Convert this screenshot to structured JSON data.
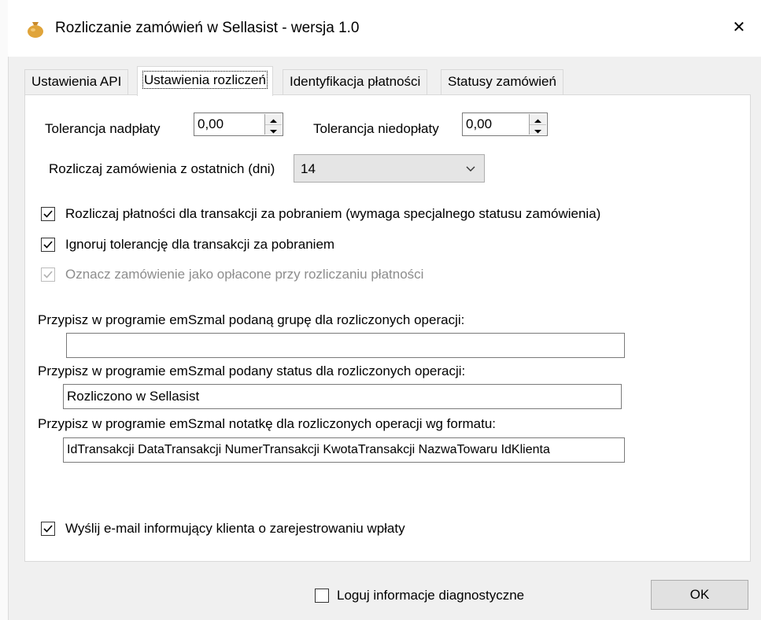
{
  "window": {
    "title": "Rozliczanie zamówień w Sellasist - wersja 1.0",
    "close_glyph": "✕"
  },
  "tabs": [
    {
      "label": "Ustawienia API",
      "active": false
    },
    {
      "label": "Ustawienia rozliczeń",
      "active": true
    },
    {
      "label": "Identyfikacja płatności",
      "active": false
    },
    {
      "label": "Statusy zamówień",
      "active": false
    }
  ],
  "settings": {
    "overpayment_label": "Tolerancja nadpłaty",
    "overpayment_value": "0,00",
    "underpayment_label": "Tolerancja niedopłaty",
    "underpayment_value": "0,00",
    "days_label": "Rozliczaj zamówienia z ostatnich (dni)",
    "days_value": "14"
  },
  "checkboxes": [
    {
      "label": "Rozliczaj płatności dla transakcji za pobraniem (wymaga specjalnego statusu zamówienia)",
      "checked": true,
      "disabled": false
    },
    {
      "label": "Ignoruj tolerancję dla transakcji za pobraniem",
      "checked": true,
      "disabled": false
    },
    {
      "label": "Oznacz zamówienie jako opłacone przy rozliczaniu płatności",
      "checked": true,
      "disabled": true
    }
  ],
  "fields": {
    "group_label": "Przypisz w programie emSzmal podaną grupę dla rozliczonych operacji:",
    "group_value": "",
    "status_label": "Przypisz w programie emSzmal podany status dla rozliczonych operacji:",
    "status_value": "Rozliczono w Sellasist",
    "note_label": "Przypisz w programie emSzmal notatkę dla rozliczonych operacji wg formatu:",
    "note_value": "IdTransakcji DataTransakcji NumerTransakcji KwotaTransakcji NazwaTowaru IdKlienta"
  },
  "email_checkbox": {
    "label": "Wyślij e-mail informujący klienta o zarejestrowaniu wpłaty",
    "checked": true
  },
  "footer": {
    "log_label": "Loguj informacje diagnostyczne",
    "log_checked": false,
    "ok_label": "OK"
  }
}
